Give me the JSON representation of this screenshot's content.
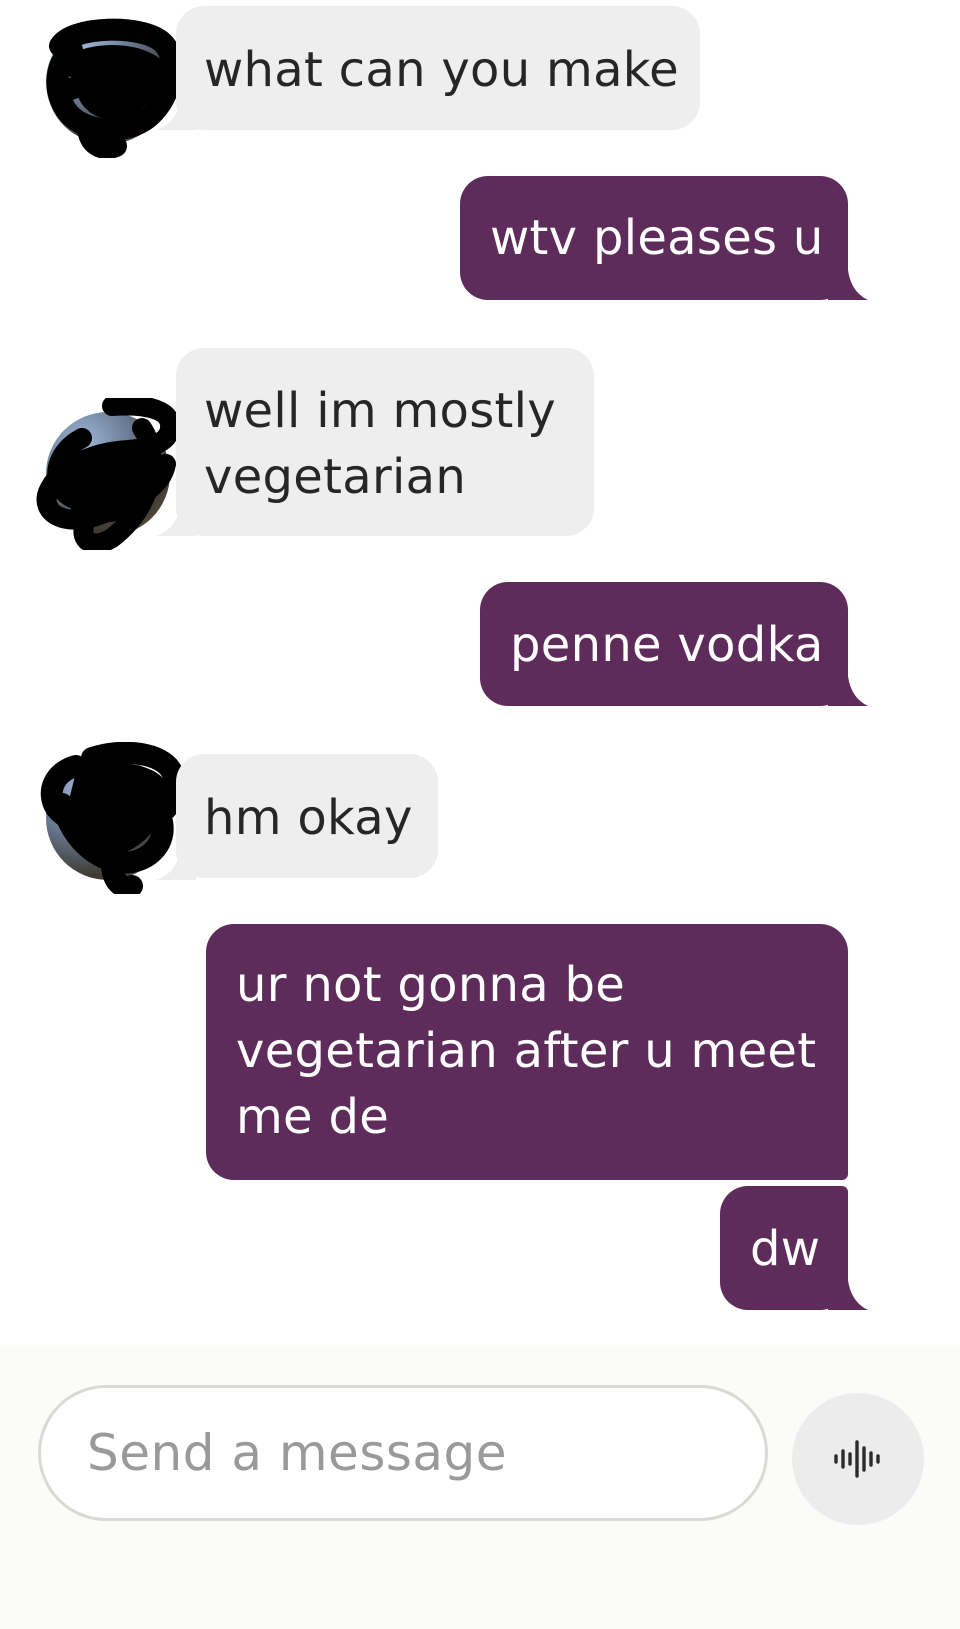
{
  "conversation": {
    "messages": [
      {
        "direction": "in",
        "text": "what can you make"
      },
      {
        "direction": "out",
        "text": "wtv pleases u"
      },
      {
        "direction": "in",
        "line1": "well im mostly",
        "line2": "vegetarian"
      },
      {
        "direction": "out",
        "text": "penne vodka"
      },
      {
        "direction": "in",
        "text": "hm okay"
      },
      {
        "direction": "out",
        "line1": "ur not gonna be",
        "line2": "vegetarian after u meet",
        "line3": "me de"
      },
      {
        "direction": "out",
        "text": "dw"
      }
    ]
  },
  "composer": {
    "placeholder": "Send a message",
    "voice_icon": "voice-waveform-icon"
  },
  "colors": {
    "incoming_bubble": "#eeeeee",
    "outgoing_bubble": "#5e2c5b",
    "incoming_text": "#262626",
    "outgoing_text": "#ffffff"
  }
}
